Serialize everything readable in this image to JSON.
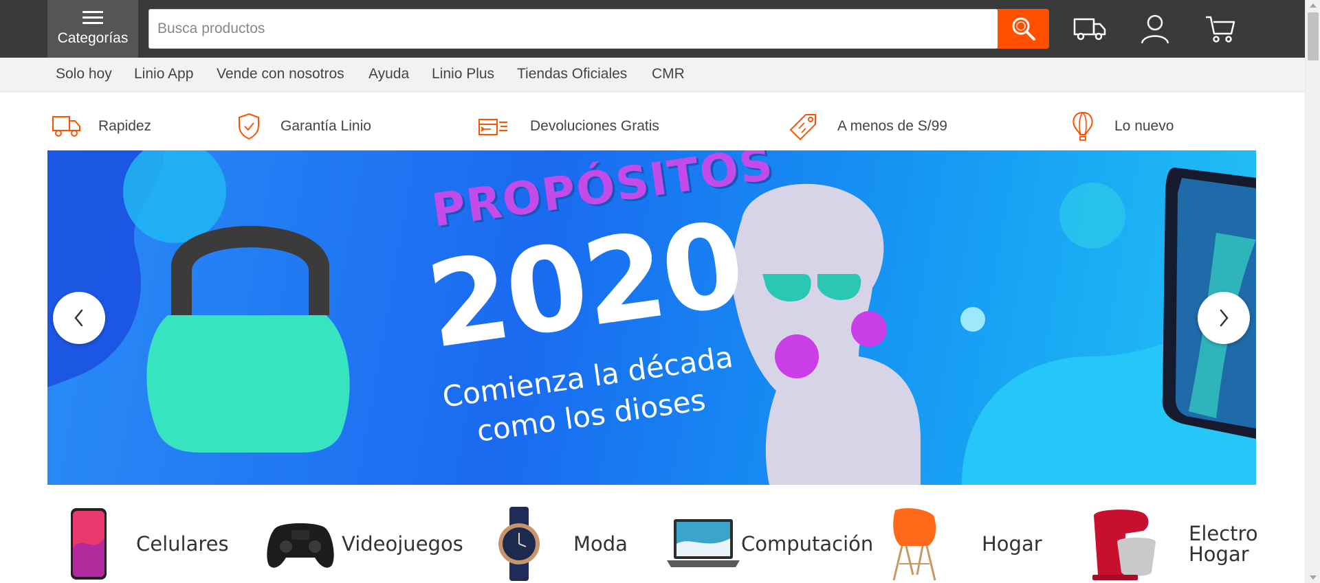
{
  "header": {
    "categories_label": "Categorías",
    "search_placeholder": "Busca productos",
    "icons": [
      "menu-icon",
      "search-icon",
      "delivery-truck-icon",
      "user-icon",
      "cart-icon"
    ]
  },
  "subnav": {
    "links": [
      "Solo hoy",
      "Linio App",
      "Vende con nosotros",
      "Ayuda",
      "Linio Plus",
      "Tiendas Oficiales",
      "CMR"
    ]
  },
  "benefits": [
    {
      "label": "Rapidez",
      "icon": "fast-truck-icon"
    },
    {
      "label": "Garantía Linio",
      "icon": "shield-check-icon"
    },
    {
      "label": "Devoluciones Gratis",
      "icon": "return-box-icon"
    },
    {
      "label": "A menos de S/99",
      "icon": "price-tag-icon"
    },
    {
      "label": "Lo nuevo",
      "icon": "hot-air-balloon-icon"
    }
  ],
  "banner": {
    "kicker": "PROPÓSITOS",
    "year": "2020",
    "tagline_1": "Comienza la década",
    "tagline_2": "como los dioses",
    "prev_icon": "chevron-left-icon",
    "next_icon": "chevron-right-icon"
  },
  "categories": [
    {
      "label": "Celulares",
      "icon": "smartphone-image"
    },
    {
      "label": "Videojuegos",
      "icon": "gamepad-image"
    },
    {
      "label": "Moda",
      "icon": "wristwatch-image"
    },
    {
      "label": "Computación",
      "icon": "laptop-image"
    },
    {
      "label": "Hogar",
      "icon": "chair-image"
    },
    {
      "label": "Electro",
      "label_2": "Hogar",
      "icon": "stand-mixer-image"
    }
  ],
  "colors": {
    "accent": "#ff5000",
    "header_bg": "#3a3a3a",
    "subnav_bg": "#f2f2f2",
    "banner_blue": "#1a6af0"
  }
}
